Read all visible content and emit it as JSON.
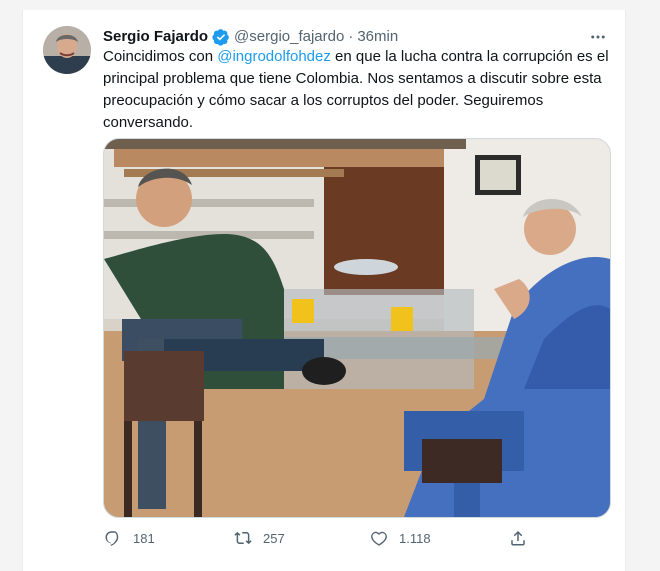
{
  "tweet": {
    "author_name": "Sergio Fajardo",
    "handle": "@sergio_fajardo",
    "separator": "·",
    "time": "36min",
    "text_before": "Coincidimos con ",
    "mention": "@ingrodolfohdez",
    "text_after": " en que la lucha contra la corrupción es el principal problema que tiene Colombia. Nos sentamos a discutir sobre esta preocupación y cómo sacar a los corruptos del poder. Seguiremos conversando."
  },
  "actions": {
    "replies": "181",
    "retweets": "257",
    "likes": "1.118"
  },
  "icons": {
    "verified": "verified-badge-icon",
    "more": "more-icon",
    "reply": "reply-icon",
    "retweet": "retweet-icon",
    "like": "heart-icon",
    "share": "share-icon"
  },
  "colors": {
    "brand_blue": "#1d9bf0",
    "text": "#0f1419",
    "muted": "#536471"
  }
}
